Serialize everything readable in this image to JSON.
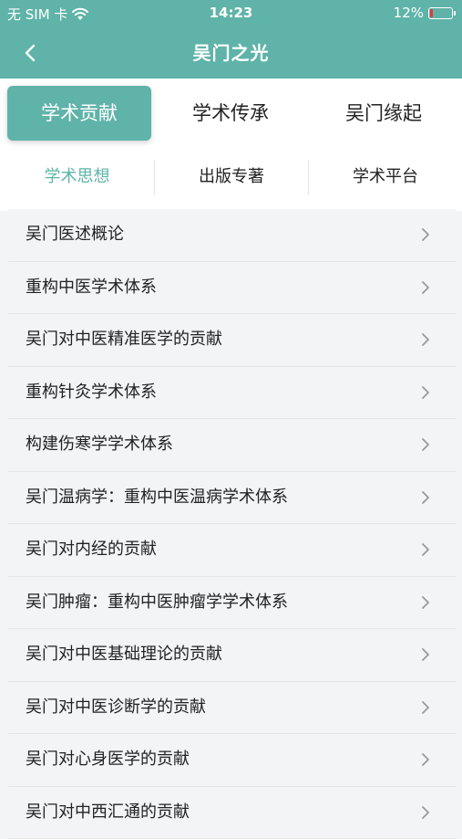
{
  "status_bar": {
    "carrier": "无 SIM 卡",
    "time": "14:23",
    "battery_percent": "12%",
    "battery_level": 0.12,
    "battery_color": "#e53935"
  },
  "nav": {
    "title": "吴门之光",
    "back_icon": "chevron-left-icon"
  },
  "theme": {
    "accent": "#5fb3a8"
  },
  "tabs": [
    {
      "label": "学术贡献",
      "active": true
    },
    {
      "label": "学术传承",
      "active": false
    },
    {
      "label": "吴门缘起",
      "active": false
    }
  ],
  "subtabs": [
    {
      "label": "学术思想",
      "active": true
    },
    {
      "label": "出版专著",
      "active": false
    },
    {
      "label": "学术平台",
      "active": false
    }
  ],
  "list": [
    {
      "label": "吴门医述概论"
    },
    {
      "label": "重构中医学术体系"
    },
    {
      "label": "吴门对中医精准医学的贡献"
    },
    {
      "label": "重构针灸学术体系"
    },
    {
      "label": "构建伤寒学学术体系"
    },
    {
      "label": "吴门温病学：重构中医温病学术体系"
    },
    {
      "label": "吴门对内经的贡献"
    },
    {
      "label": "吴门肿瘤：重构中医肿瘤学学术体系"
    },
    {
      "label": "吴门对中医基础理论的贡献"
    },
    {
      "label": "吴门对中医诊断学的贡献"
    },
    {
      "label": "吴门对心身医学的贡献"
    },
    {
      "label": "吴门对中西汇通的贡献"
    }
  ]
}
